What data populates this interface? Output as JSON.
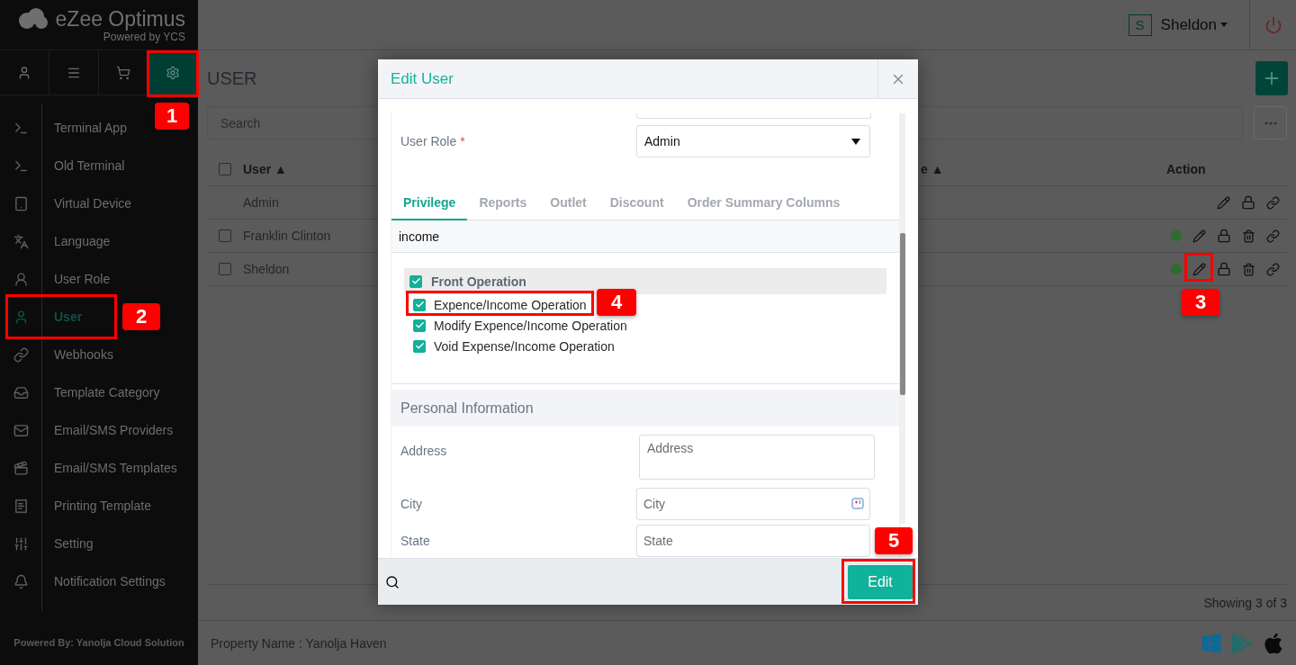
{
  "brand": {
    "name": "eZee Optimus",
    "tagline": "Powered by YCS"
  },
  "top_tabs": [
    {
      "kind": "user",
      "selected": false
    },
    {
      "kind": "menu",
      "selected": false
    },
    {
      "kind": "cart",
      "selected": false
    },
    {
      "kind": "settings",
      "selected": true
    }
  ],
  "sidebar": {
    "items": [
      {
        "kind": "terminal",
        "label": "Terminal App",
        "selected": false
      },
      {
        "kind": "terminal",
        "label": "Old Terminal",
        "selected": false
      },
      {
        "kind": "tablet",
        "label": "Virtual Device",
        "selected": false
      },
      {
        "kind": "language",
        "label": "Language",
        "selected": false
      },
      {
        "kind": "person",
        "label": "User Role",
        "selected": false
      },
      {
        "kind": "user",
        "label": "User",
        "selected": true
      },
      {
        "kind": "link",
        "label": "Webhooks",
        "selected": false
      },
      {
        "kind": "inbox",
        "label": "Template Category",
        "selected": false
      },
      {
        "kind": "mail",
        "label": "Email/SMS Providers",
        "selected": false
      },
      {
        "kind": "film",
        "label": "Email/SMS Templates",
        "selected": false
      },
      {
        "kind": "receipt",
        "label": "Printing Template",
        "selected": false
      },
      {
        "kind": "sliders",
        "label": "Setting",
        "selected": false
      },
      {
        "kind": "bell",
        "label": "Notification Settings",
        "selected": false
      }
    ],
    "footer": "Powered By: Yanolja Cloud Solution"
  },
  "header": {
    "avatar": "S",
    "user": "Sheldon"
  },
  "page": {
    "title": "USER",
    "search_placeholder": "Search",
    "select_all": false,
    "columns": [
      {
        "label": "User",
        "sort": "▲"
      },
      {
        "label": "e",
        "sort": "▲"
      },
      {
        "label": "Action"
      }
    ],
    "rows": [
      {
        "user": "Admin",
        "deletable": false
      },
      {
        "user": "Franklin Clinton",
        "checked": false,
        "deletable": true,
        "color": "#2f6b2f"
      },
      {
        "user": "Sheldon",
        "checked": false,
        "deletable": true,
        "color": "#2f6b2f"
      }
    ],
    "count": "Showing 3 of 3"
  },
  "bottom_bar": {
    "property": "Property Name : Yanolja Haven"
  },
  "modal": {
    "title": "Edit User",
    "role": {
      "label": "User Role",
      "required_mark": "*",
      "value": "Admin"
    },
    "tabs": [
      {
        "label": "Privilege",
        "selected": true
      },
      {
        "label": "Reports",
        "selected": false
      },
      {
        "label": "Outlet",
        "selected": false
      },
      {
        "label": "Discount",
        "selected": false
      },
      {
        "label": "Order Summary Columns",
        "selected": false
      }
    ],
    "filter": "income",
    "tree": [
      {
        "label": "Front Operation",
        "checked": true,
        "children": [
          {
            "label": "Expence/Income Operation",
            "checked": true
          },
          {
            "label": "Modify Expence/Income Operation",
            "checked": true
          },
          {
            "label": "Void Expense/Income Operation",
            "checked": true
          }
        ]
      }
    ],
    "section": "Personal Information",
    "fields": [
      {
        "kind": "textarea",
        "label": "Address",
        "placeholder": "Address"
      },
      {
        "kind": "input",
        "label": "City",
        "placeholder": "City"
      },
      {
        "kind": "input",
        "label": "State",
        "placeholder": "State"
      }
    ],
    "button": "Edit"
  },
  "annotations": [
    {
      "label": "1"
    },
    {
      "label": "2"
    },
    {
      "label": "3"
    },
    {
      "label": "4"
    },
    {
      "label": "5"
    }
  ]
}
